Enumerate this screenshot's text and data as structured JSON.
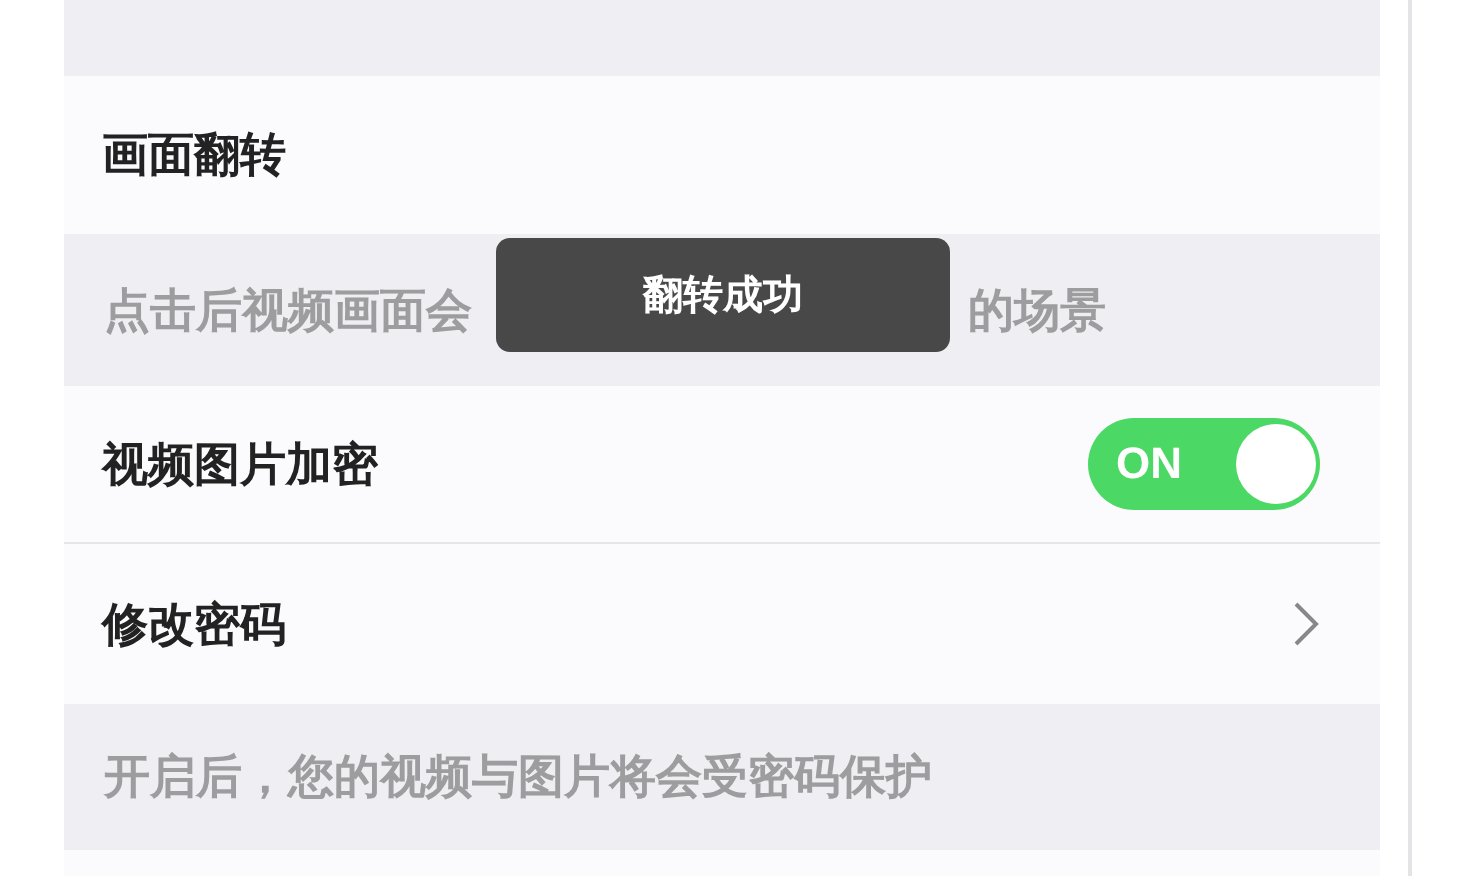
{
  "sections": [
    {
      "kind": "row",
      "label": "画面翻转"
    },
    {
      "kind": "hint",
      "parts": [
        "点击后视频画面会",
        "的场景"
      ]
    },
    {
      "kind": "toggle",
      "label": "视频图片加密",
      "on": true,
      "on_text": "ON"
    },
    {
      "kind": "link",
      "label": "修改密码"
    },
    {
      "kind": "hint",
      "text": "开启后，您的视频与图片将会受密码保护"
    }
  ],
  "toast": {
    "text": "翻转成功"
  }
}
